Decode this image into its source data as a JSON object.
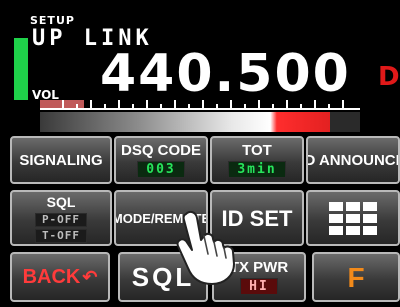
{
  "display": {
    "setup_label": "SETUP",
    "mode": "UP LINK",
    "vol_label": "VOL",
    "frequency": "440.500",
    "right_indicator": "DN"
  },
  "softkeys": {
    "row1": {
      "signaling": {
        "label": "SIGNALING"
      },
      "dsq_code": {
        "label": "DSQ CODE",
        "value": "003"
      },
      "tot": {
        "label": "TOT",
        "value": "3min"
      },
      "id_announce": {
        "label": "ID ANNOUNCE"
      }
    },
    "row2": {
      "sql_mode": {
        "label": "SQL",
        "value_line1": "P-OFF",
        "value_line2": "T-OFF"
      },
      "mode_remote": {
        "label": "MODE/REMOTE"
      },
      "id_set": {
        "label": "ID SET"
      },
      "grid_icon": "grid-icon"
    },
    "row3": {
      "back": {
        "label": "BACK"
      },
      "sql": {
        "label": "SQL"
      },
      "tx_pwr": {
        "label": "TX PWR",
        "value": "HI"
      },
      "f": {
        "label": "F"
      }
    }
  },
  "colors": {
    "accent_green": "#27e35b",
    "alert_red": "#e01919",
    "f_orange": "#f28a1a"
  }
}
